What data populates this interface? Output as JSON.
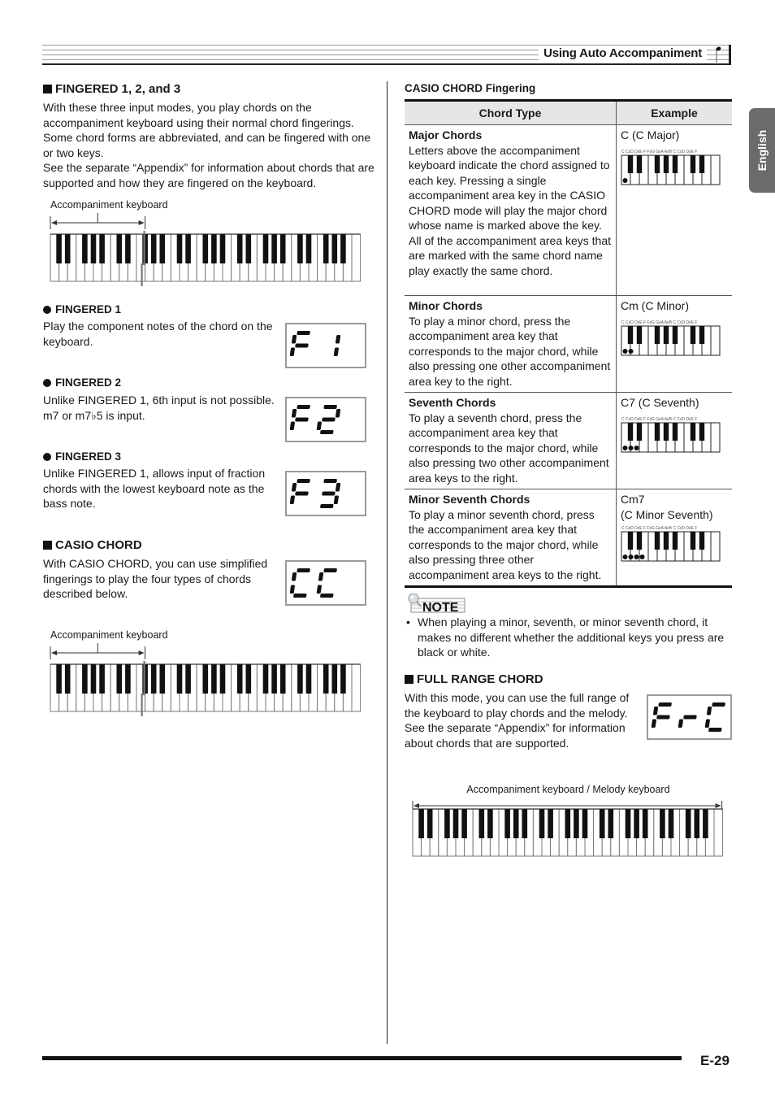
{
  "header": {
    "title": "Using Auto Accompaniment"
  },
  "side_tab": {
    "label": "English"
  },
  "left": {
    "fingered": {
      "heading": "FINGERED 1, 2, and 3",
      "paragraphs": [
        "With these three input modes, you play chords on the accompaniment keyboard using their normal chord fingerings. Some chord forms are abbreviated, and can be fingered with one or two keys.",
        "See the separate “Appendix” for information about chords that are supported and how they are fingered on the keyboard."
      ],
      "keyboard_label": "Accompaniment keyboard",
      "modes": [
        {
          "heading": "FINGERED 1",
          "text": "Play the component notes of the chord on the keyboard.",
          "display": "F1"
        },
        {
          "heading": "FINGERED 2",
          "text": "Unlike FINGERED 1, 6th input is not possible. m7 or m7♭5 is input.",
          "display": "F2"
        },
        {
          "heading": "FINGERED 3",
          "text": "Unlike FINGERED 1, allows input of fraction chords with the lowest keyboard note as the bass note.",
          "display": "F3"
        }
      ]
    },
    "casio_chord": {
      "heading": "CASIO CHORD",
      "text": "With CASIO CHORD, you can use simplified fingerings to play the four types of chords described below.",
      "display": "CC",
      "keyboard_label": "Accompaniment keyboard"
    }
  },
  "right": {
    "table_title": "CASIO CHORD Fingering",
    "columns": [
      "Chord Type",
      "Example"
    ],
    "rows": [
      {
        "type": "Major Chords",
        "desc": "Letters above the accompaniment keyboard indicate the chord assigned to each key. Pressing a single accompaniment area key in the CASIO CHORD mode will play the major chord whose name is marked above the key. All of the accompaniment area keys that are marked with the same chord name play exactly the same chord.",
        "example": "C (C Major)",
        "pressed_keys": 1
      },
      {
        "type": "Minor Chords",
        "desc": "To play a minor chord, press the accompaniment area key that corresponds to the major chord, while also pressing one other accompaniment area key to the right.",
        "example": "Cm (C Minor)",
        "pressed_keys": 2
      },
      {
        "type": "Seventh Chords",
        "desc": "To play a seventh chord, press the accompaniment area key that corresponds to the major chord, while also pressing two other accompaniment area keys to the right.",
        "example": "C7 (C Seventh)",
        "pressed_keys": 3
      },
      {
        "type": "Minor Seventh Chords",
        "desc": "To play a minor seventh chord, press the accompaniment area key that corresponds to the major chord, while also pressing three other accompaniment area keys to the right.",
        "example": "Cm7\n(C Minor Seventh)",
        "pressed_keys": 4
      }
    ],
    "mini_keyboard_letters": "C C♯D D♯E F F♯G G♯A A♯B C C♯D D♯E F",
    "note": {
      "badge": "NOTE",
      "text": "When playing a minor, seventh, or minor seventh chord, it makes no different whether the additional keys you press are black or white."
    },
    "full_range": {
      "heading": "FULL RANGE CHORD",
      "paragraphs": [
        "With this mode, you can use the full range of the keyboard to play chords and the melody.",
        "See the separate “Appendix” for information about chords that are supported."
      ],
      "display": "FrC",
      "keyboard_label": "Accompaniment keyboard / Melody keyboard"
    }
  },
  "footer": {
    "page": "E-29"
  }
}
